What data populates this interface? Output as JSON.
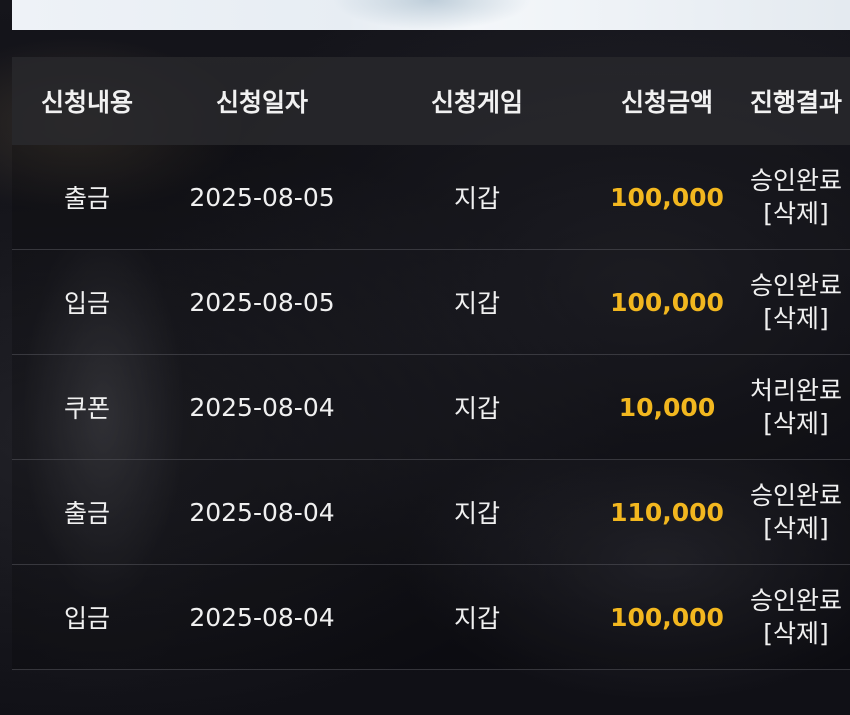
{
  "table": {
    "headers": [
      "신청내용",
      "신청일자",
      "신청게임",
      "신청금액",
      "진행결과"
    ],
    "rows": [
      {
        "type": "출금",
        "date": "2025-08-05",
        "game": "지갑",
        "amount": "100,000",
        "status": "승인완료",
        "action": "[삭제]"
      },
      {
        "type": "입금",
        "date": "2025-08-05",
        "game": "지갑",
        "amount": "100,000",
        "status": "승인완료",
        "action": "[삭제]"
      },
      {
        "type": "쿠폰",
        "date": "2025-08-04",
        "game": "지갑",
        "amount": "10,000",
        "status": "처리완료",
        "action": "[삭제]"
      },
      {
        "type": "출금",
        "date": "2025-08-04",
        "game": "지갑",
        "amount": "110,000",
        "status": "승인완료",
        "action": "[삭제]"
      },
      {
        "type": "입금",
        "date": "2025-08-04",
        "game": "지갑",
        "amount": "100,000",
        "status": "승인완료",
        "action": "[삭제]"
      }
    ]
  },
  "colors": {
    "amount": "#f2b71f",
    "header_bg": "#28282c",
    "text": "#f0f0f0"
  }
}
